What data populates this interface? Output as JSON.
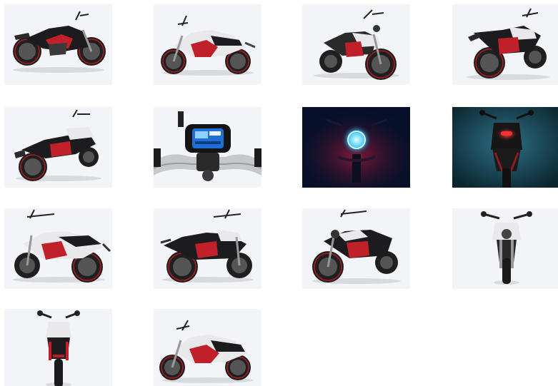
{
  "gallery": {
    "thumbnails": [
      {
        "name": "thumb-black-side-right",
        "variant": "black",
        "view": "side-right"
      },
      {
        "name": "thumb-white-side-left",
        "variant": "white",
        "view": "side-left"
      },
      {
        "name": "thumb-white-front-three-quarter",
        "variant": "white",
        "view": "front-quarter"
      },
      {
        "name": "thumb-black-rear-three-quarter",
        "variant": "black",
        "view": "rear-quarter"
      },
      {
        "name": "thumb-white-rear-side",
        "variant": "white",
        "view": "side-right"
      },
      {
        "name": "thumb-dashboard-closeup",
        "variant": "detail",
        "view": "dashboard"
      },
      {
        "name": "thumb-headlight-night",
        "variant": "night-blue",
        "view": "front"
      },
      {
        "name": "thumb-taillight-night",
        "variant": "night-red",
        "view": "rear"
      },
      {
        "name": "thumb-white-side-right",
        "variant": "white",
        "view": "side-right"
      },
      {
        "name": "thumb-black-side-left",
        "variant": "black",
        "view": "side-left"
      },
      {
        "name": "thumb-black-front-quarter",
        "variant": "black",
        "view": "front-quarter"
      },
      {
        "name": "thumb-white-front",
        "variant": "white",
        "view": "front"
      },
      {
        "name": "thumb-black-rear",
        "variant": "black",
        "view": "rear"
      },
      {
        "name": "thumb-white-side-left-2",
        "variant": "white",
        "view": "side-left"
      }
    ]
  },
  "colors": {
    "tile_bg": "#f3f4f7",
    "frame_red": "#c0202a",
    "tank_black": "#1c1c1e",
    "tank_white": "#e9e9ec",
    "wheel": "#222222",
    "night_blue": "#07102a",
    "night_teal": "#123c4c"
  }
}
